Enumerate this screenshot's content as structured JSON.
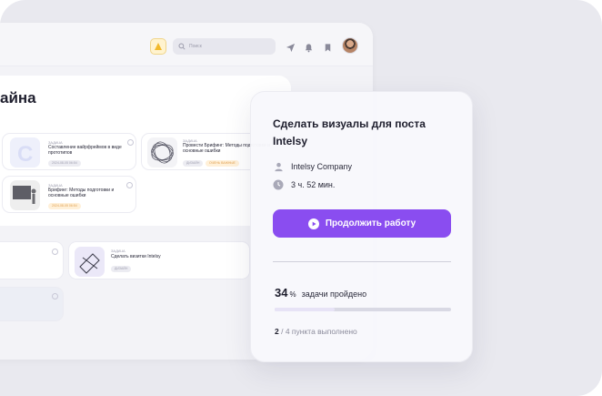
{
  "app": {
    "search_placeholder": "Поиск",
    "page_title": "айна"
  },
  "cards": [
    {
      "label": "ЗАДАЧА",
      "title": "Составление вайрфреймов в виде прототипов",
      "chips": [
        "2024-08-05 06:54"
      ]
    },
    {
      "label": "ЗАДАЧА",
      "title": "Провести Брифинг: Методы подготовки и основные ошибки",
      "chips": [
        "ДИЗАЙН",
        "ОЧЕНЬ ВАЖНЫЕ"
      ]
    },
    {
      "label": "ЗАДАЧА",
      "title": "Брифинг: Методы подготовки и основные ошибки",
      "chips": [
        "2024-08-05 06:54"
      ]
    },
    {
      "label": "ЗАДАЧА",
      "title": "Сделать визитки Intelsy",
      "chips": [
        "ДИЗАЙН"
      ]
    }
  ],
  "modal": {
    "title": "Сделать визуалы для поста Intelsy",
    "company": "Intelsy Company",
    "duration": "3 ч. 52 мин.",
    "cta_label": "Продолжить работу",
    "progress_value": "34",
    "progress_unit": "%",
    "progress_label": "задачи пройдено",
    "progress_fraction": 0.34,
    "steps_done": "2",
    "steps_rest": "/ 4 пункта выполнено"
  },
  "colors": {
    "accent": "#8a4df0",
    "logo_badge": "#fff3cf"
  }
}
